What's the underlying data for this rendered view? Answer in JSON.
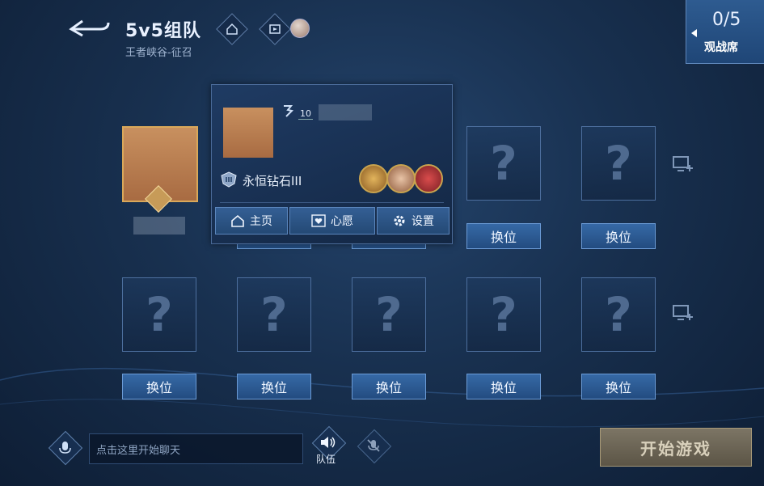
{
  "header": {
    "title": "5v5组队",
    "subtitle": "王者峡谷-征召"
  },
  "spectator": {
    "count": "0/5",
    "label": "观战席"
  },
  "slots": {
    "placeholder": "?",
    "swap_label": "换位"
  },
  "player_popup": {
    "level": "10",
    "rank": "永恒钻石III",
    "buttons": {
      "home": "主页",
      "wish": "心愿",
      "settings": "设置"
    }
  },
  "chat": {
    "placeholder": "点击这里开始聊天"
  },
  "voice": {
    "team_label": "队伍"
  },
  "start_button": "开始游戏",
  "icons": [
    "back-icon",
    "home-icon",
    "video-icon",
    "add-screen-icon",
    "mic-icon",
    "speaker-icon",
    "mic-off-icon",
    "rank-icon",
    "heart-icon",
    "gear-icon"
  ]
}
